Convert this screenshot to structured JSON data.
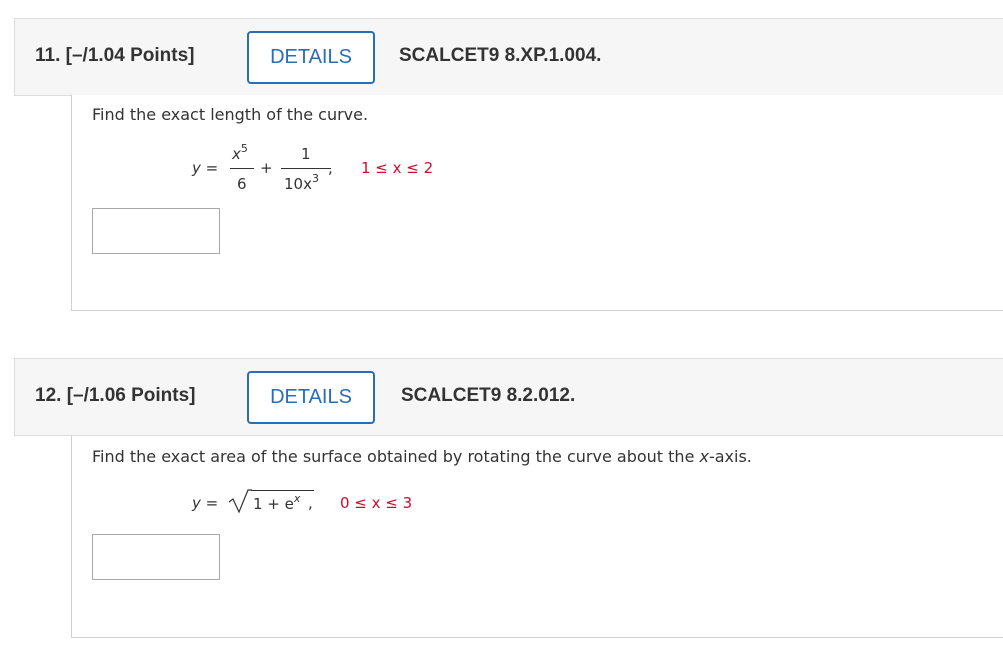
{
  "q11": {
    "title": "11.  [–/1.04 Points]",
    "details_label": "DETAILS",
    "code": "SCALCET9 8.XP.1.004.",
    "prompt": "Find the exact length of the curve.",
    "eq_lhs": "y =",
    "num1_base": "x",
    "num1_exp": "5",
    "den1": "6",
    "plus": "+",
    "num2": "1",
    "den2_base": "10x",
    "den2_exp": "3",
    "comma": ",",
    "range_text": "1 ≤ x ≤ 2"
  },
  "q12": {
    "title": "12.  [–/1.06 Points]",
    "details_label": "DETAILS",
    "code": "SCALCET9 8.2.012.",
    "prompt_pre": "Find the exact area of the surface obtained by rotating the curve about the ",
    "prompt_var": "x",
    "prompt_post": "-axis.",
    "eq_lhs": "y =",
    "radicand_pre": "1 + e",
    "radicand_exp": "x",
    "comma": ",",
    "range_text": "0 ≤ x ≤ 3"
  }
}
